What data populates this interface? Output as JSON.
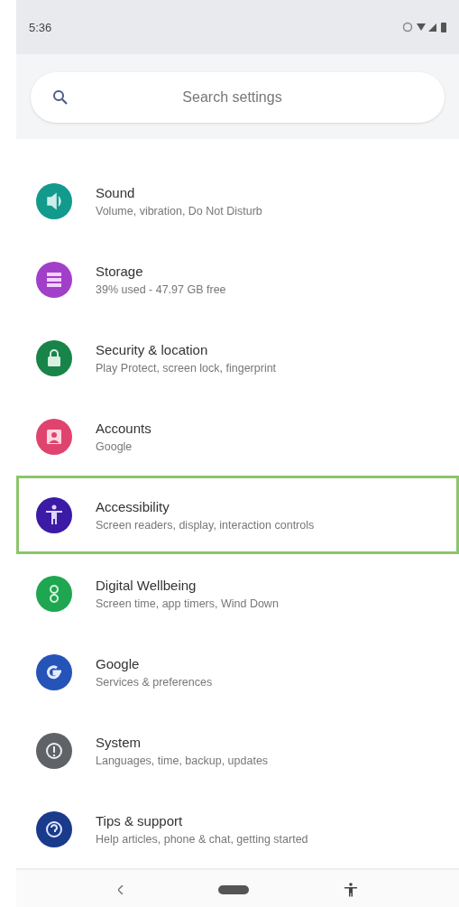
{
  "status_bar": {
    "time": "5:36"
  },
  "search": {
    "placeholder": "Search settings"
  },
  "items": [
    {
      "kind": "sound",
      "title": "Sound",
      "subtitle": "Volume, vibration, Do Not Disturb",
      "color": "#129a8d",
      "selected": false
    },
    {
      "kind": "storage",
      "title": "Storage",
      "subtitle": "39% used - 47.97 GB free",
      "color": "#a23fc9",
      "selected": false
    },
    {
      "kind": "security",
      "title": "Security & location",
      "subtitle": "Play Protect, screen lock, fingerprint",
      "color": "#19844a",
      "selected": false
    },
    {
      "kind": "accounts",
      "title": "Accounts",
      "subtitle": "Google",
      "color": "#e0446e",
      "selected": false
    },
    {
      "kind": "accessibility",
      "title": "Accessibility",
      "subtitle": "Screen readers, display, interaction controls",
      "color": "#3b1aa5",
      "selected": true
    },
    {
      "kind": "wellbeing",
      "title": "Digital Wellbeing",
      "subtitle": "Screen time, app timers, Wind Down",
      "color": "#1fa650",
      "selected": false
    },
    {
      "kind": "google",
      "title": "Google",
      "subtitle": "Services & preferences",
      "color": "#2553b8",
      "selected": false
    },
    {
      "kind": "system",
      "title": "System",
      "subtitle": "Languages, time, backup, updates",
      "color": "#5f6368",
      "selected": false
    },
    {
      "kind": "tips",
      "title": "Tips & support",
      "subtitle": "Help articles, phone & chat, getting started",
      "color": "#1a3a8c",
      "selected": false
    }
  ]
}
